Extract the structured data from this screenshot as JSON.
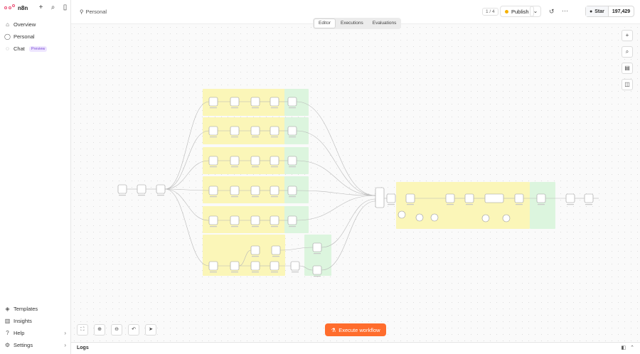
{
  "brand": {
    "name": "n8n"
  },
  "sidebar": {
    "top": [
      {
        "label": "Overview",
        "icon": "home-icon"
      },
      {
        "label": "Personal",
        "icon": "user-icon"
      },
      {
        "label": "Chat",
        "icon": "chat-icon",
        "badge": "Preview"
      }
    ],
    "bottom": [
      {
        "label": "Templates",
        "icon": "templates-icon"
      },
      {
        "label": "Insights",
        "icon": "insights-icon"
      },
      {
        "label": "Help",
        "icon": "help-icon"
      },
      {
        "label": "Settings",
        "icon": "gear-icon"
      }
    ]
  },
  "header": {
    "breadcrumb": "Personal",
    "counter": "1 / 4",
    "publish_label": "Publish",
    "star_label": "Star",
    "star_count": "197,429"
  },
  "tabs": [
    {
      "label": "Editor",
      "active": true
    },
    {
      "label": "Executions",
      "active": false
    },
    {
      "label": "Evaluations",
      "active": false
    }
  ],
  "execute_label": "Execute workflow",
  "logs_label": "Logs",
  "colors": {
    "accent": "#ff6d2d",
    "brand": "#ea4b71",
    "sticky_yellow": "#fbf6b8",
    "sticky_green": "#dcf5de"
  }
}
